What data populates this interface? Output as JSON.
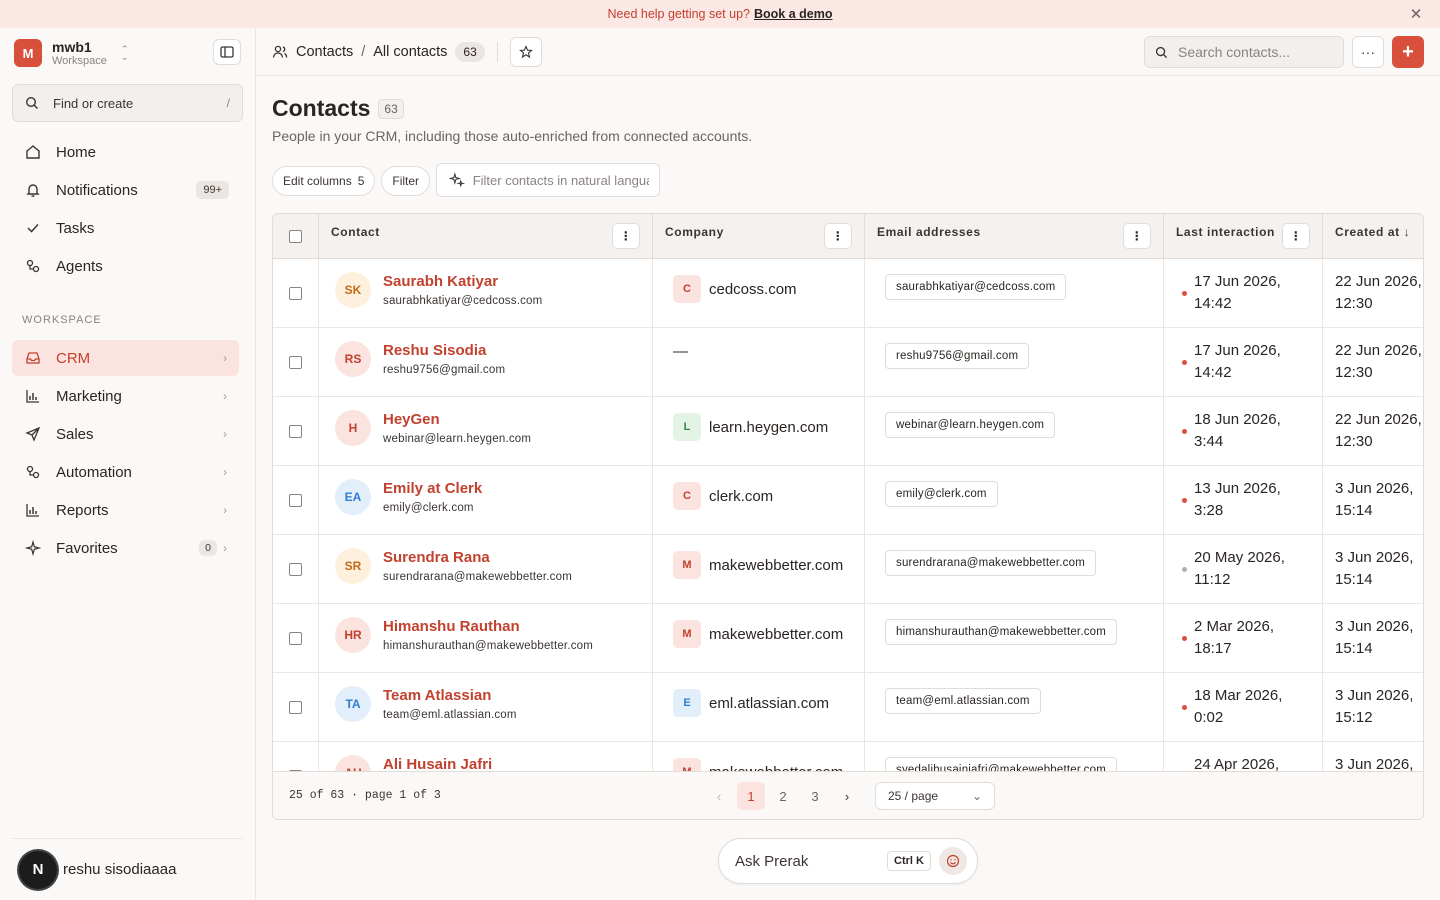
{
  "banner": {
    "text": "Need help getting set up?",
    "link": "Book a demo",
    "close_icon": "close-icon"
  },
  "workspace": {
    "badge": "M",
    "name": "mwb1",
    "sub": "Workspace"
  },
  "sidebar": {
    "find": {
      "label": "Find or create",
      "shortcut": "/"
    },
    "top_items": [
      {
        "label": "Home",
        "icon": "home-icon"
      },
      {
        "label": "Notifications",
        "icon": "bell-icon",
        "count": "99+"
      },
      {
        "label": "Tasks",
        "icon": "check-icon"
      },
      {
        "label": "Agents",
        "icon": "agents-icon"
      }
    ],
    "section_label": "WORKSPACE",
    "workspace_items": [
      {
        "label": "CRM",
        "icon": "inbox-icon",
        "active": true
      },
      {
        "label": "Marketing",
        "icon": "chart-icon"
      },
      {
        "label": "Sales",
        "icon": "send-icon"
      },
      {
        "label": "Automation",
        "icon": "automation-icon"
      },
      {
        "label": "Reports",
        "icon": "chart-icon"
      },
      {
        "label": "Favorites",
        "icon": "sparkle-icon",
        "count": "0"
      }
    ],
    "user": {
      "avatar": "N",
      "name": "reshu sisodiaaaa"
    }
  },
  "header": {
    "crumb_root": "Contacts",
    "crumb_sep": "/",
    "crumb_current": "All contacts",
    "crumb_count": "63",
    "search_placeholder": "Search contacts...",
    "more_label": "···",
    "add_label": "+"
  },
  "page": {
    "title": "Contacts",
    "count": "63",
    "subtitle": "People in your CRM, including those auto-enriched from connected accounts.",
    "edit_columns": "Edit columns",
    "edit_columns_count": "5",
    "filter": "Filter",
    "nl_filter_placeholder": "Filter contacts in natural langua"
  },
  "table": {
    "columns": [
      "Contact",
      "Company",
      "Email addresses",
      "Last interaction",
      "Created at"
    ],
    "column_menu_label": "⋮",
    "sort_indicator": "↓",
    "rows": [
      {
        "initials": "SK",
        "avatar_bg": "#fdf0dc",
        "avatar_fg": "#c26b1a",
        "name": "Saurabh Katiyar",
        "email": "saurabhkatiyar@cedcoss.com",
        "company_letter": "C",
        "company_bg": "#fbe3df",
        "company_fg": "#c2412f",
        "company": "cedcoss.com",
        "email_chip": "saurabhkatiyar@cedcoss.com",
        "dot": "#d8503c",
        "last_1": "17 Jun 2026,",
        "last_2": "14:42",
        "created_1": "22 Jun 2026,",
        "created_2": "12:30"
      },
      {
        "initials": "RS",
        "avatar_bg": "#fbe3df",
        "avatar_fg": "#c2412f",
        "name": "Reshu Sisodia",
        "email": "reshu9756@gmail.com",
        "company_letter": "",
        "company_bg": "",
        "company_fg": "",
        "company": "—",
        "email_chip": "reshu9756@gmail.com",
        "dot": "#d8503c",
        "last_1": "17 Jun 2026,",
        "last_2": "14:42",
        "created_1": "22 Jun 2026,",
        "created_2": "12:30"
      },
      {
        "initials": "H",
        "avatar_bg": "#fbe3df",
        "avatar_fg": "#c2412f",
        "name": "HeyGen",
        "email": "webinar@learn.heygen.com",
        "company_letter": "L",
        "company_bg": "#e3f3e6",
        "company_fg": "#2f8a45",
        "company": "learn.heygen.com",
        "email_chip": "webinar@learn.heygen.com",
        "dot": "#d8503c",
        "last_1": "18 Jun 2026,",
        "last_2": "3:44",
        "created_1": "22 Jun 2026,",
        "created_2": "12:30"
      },
      {
        "initials": "EA",
        "avatar_bg": "#e3eefb",
        "avatar_fg": "#2f7fd0",
        "name": "Emily at Clerk",
        "email": "emily@clerk.com",
        "company_letter": "C",
        "company_bg": "#fbe3df",
        "company_fg": "#c2412f",
        "company": "clerk.com",
        "email_chip": "emily@clerk.com",
        "dot": "#d8503c",
        "last_1": "13 Jun 2026,",
        "last_2": "3:28",
        "created_1": "3 Jun 2026,",
        "created_2": "15:14"
      },
      {
        "initials": "SR",
        "avatar_bg": "#fdf0dc",
        "avatar_fg": "#c26b1a",
        "name": "Surendra Rana",
        "email": "surendrarana@makewebbetter.com",
        "company_letter": "M",
        "company_bg": "#fbe3df",
        "company_fg": "#c2412f",
        "company": "makewebbetter.com",
        "email_chip": "surendrarana@makewebbetter.com",
        "dot": "#b5aeab",
        "last_1": "20 May 2026,",
        "last_2": "11:12",
        "created_1": "3 Jun 2026,",
        "created_2": "15:14"
      },
      {
        "initials": "HR",
        "avatar_bg": "#fbe3df",
        "avatar_fg": "#c2412f",
        "name": "Himanshu Rauthan",
        "email": "himanshurauthan@makewebbetter.com",
        "company_letter": "M",
        "company_bg": "#fbe3df",
        "company_fg": "#c2412f",
        "company": "makewebbetter.com",
        "email_chip": "himanshurauthan@makewebbetter.com",
        "dot": "#d8503c",
        "last_1": "2 Mar 2026,",
        "last_2": "18:17",
        "created_1": "3 Jun 2026,",
        "created_2": "15:14"
      },
      {
        "initials": "TA",
        "avatar_bg": "#e3eefb",
        "avatar_fg": "#2f7fd0",
        "name": "Team Atlassian",
        "email": "team@eml.atlassian.com",
        "company_letter": "E",
        "company_bg": "#e3eefb",
        "company_fg": "#2f7fd0",
        "company": "eml.atlassian.com",
        "email_chip": "team@eml.atlassian.com",
        "dot": "#d8503c",
        "last_1": "18 Mar 2026,",
        "last_2": "0:02",
        "created_1": "3 Jun 2026,",
        "created_2": "15:12"
      },
      {
        "initials": "AH",
        "avatar_bg": "#fbe3df",
        "avatar_fg": "#c2412f",
        "name": "Ali Husain Jafri",
        "email": "syedalihusainjafri@makewebbetter.com",
        "company_letter": "M",
        "company_bg": "#fbe3df",
        "company_fg": "#c2412f",
        "company": "makewebbetter.com",
        "email_chip": "syedalihusainjafri@makewebbetter.com",
        "dot": "#d8503c",
        "last_1": "24 Apr 2026,",
        "last_2": "",
        "created_1": "3 Jun 2026,",
        "created_2": ""
      }
    ]
  },
  "footer": {
    "info": "25 of 63 · page 1 of 3",
    "pages": [
      "1",
      "2",
      "3"
    ],
    "prev": "‹",
    "next": "›",
    "per_page": "25 / page"
  },
  "ask": {
    "label": "Ask Prerak",
    "shortcut": "Ctrl K"
  },
  "colors": {
    "accent": "#d8503c",
    "accent_text": "#c2412f",
    "active_bg": "#fbe3df",
    "banner_bg": "#fbe7e4"
  }
}
